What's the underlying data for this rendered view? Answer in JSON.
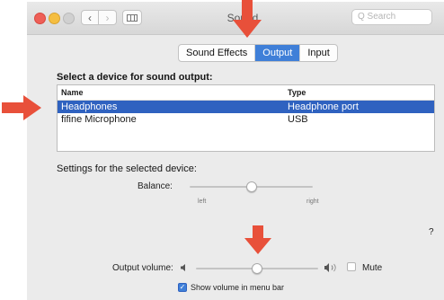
{
  "window": {
    "title": "Sound",
    "nav_back": "‹",
    "nav_forward": "›",
    "search_placeholder": "Q Search"
  },
  "tabs": [
    {
      "label": "Sound Effects",
      "active": false
    },
    {
      "label": "Output",
      "active": true
    },
    {
      "label": "Input",
      "active": false
    }
  ],
  "device_section": {
    "heading": "Select a device for sound output:",
    "columns": [
      "Name",
      "Type"
    ],
    "rows": [
      {
        "name": "Headphones",
        "type": "Headphone port",
        "selected": true
      },
      {
        "name": "fifine Microphone",
        "type": "USB",
        "selected": false
      }
    ]
  },
  "settings": {
    "heading": "Settings for the selected device:",
    "balance_label": "Balance:",
    "balance_left": "left",
    "balance_right": "right",
    "balance_value": 0.5
  },
  "help_label": "?",
  "volume": {
    "label": "Output volume:",
    "value": 0.5,
    "mute_label": "Mute",
    "mute_checked": false
  },
  "show_volume": {
    "label": "Show volume in menu bar",
    "checked": true
  },
  "colors": {
    "accent": "#3f7fd8",
    "selection": "#2f62c0",
    "annotation_arrow": "#e8503a"
  },
  "icons": {
    "speaker_low": "speaker-low-icon",
    "speaker_high": "speaker-high-icon"
  }
}
